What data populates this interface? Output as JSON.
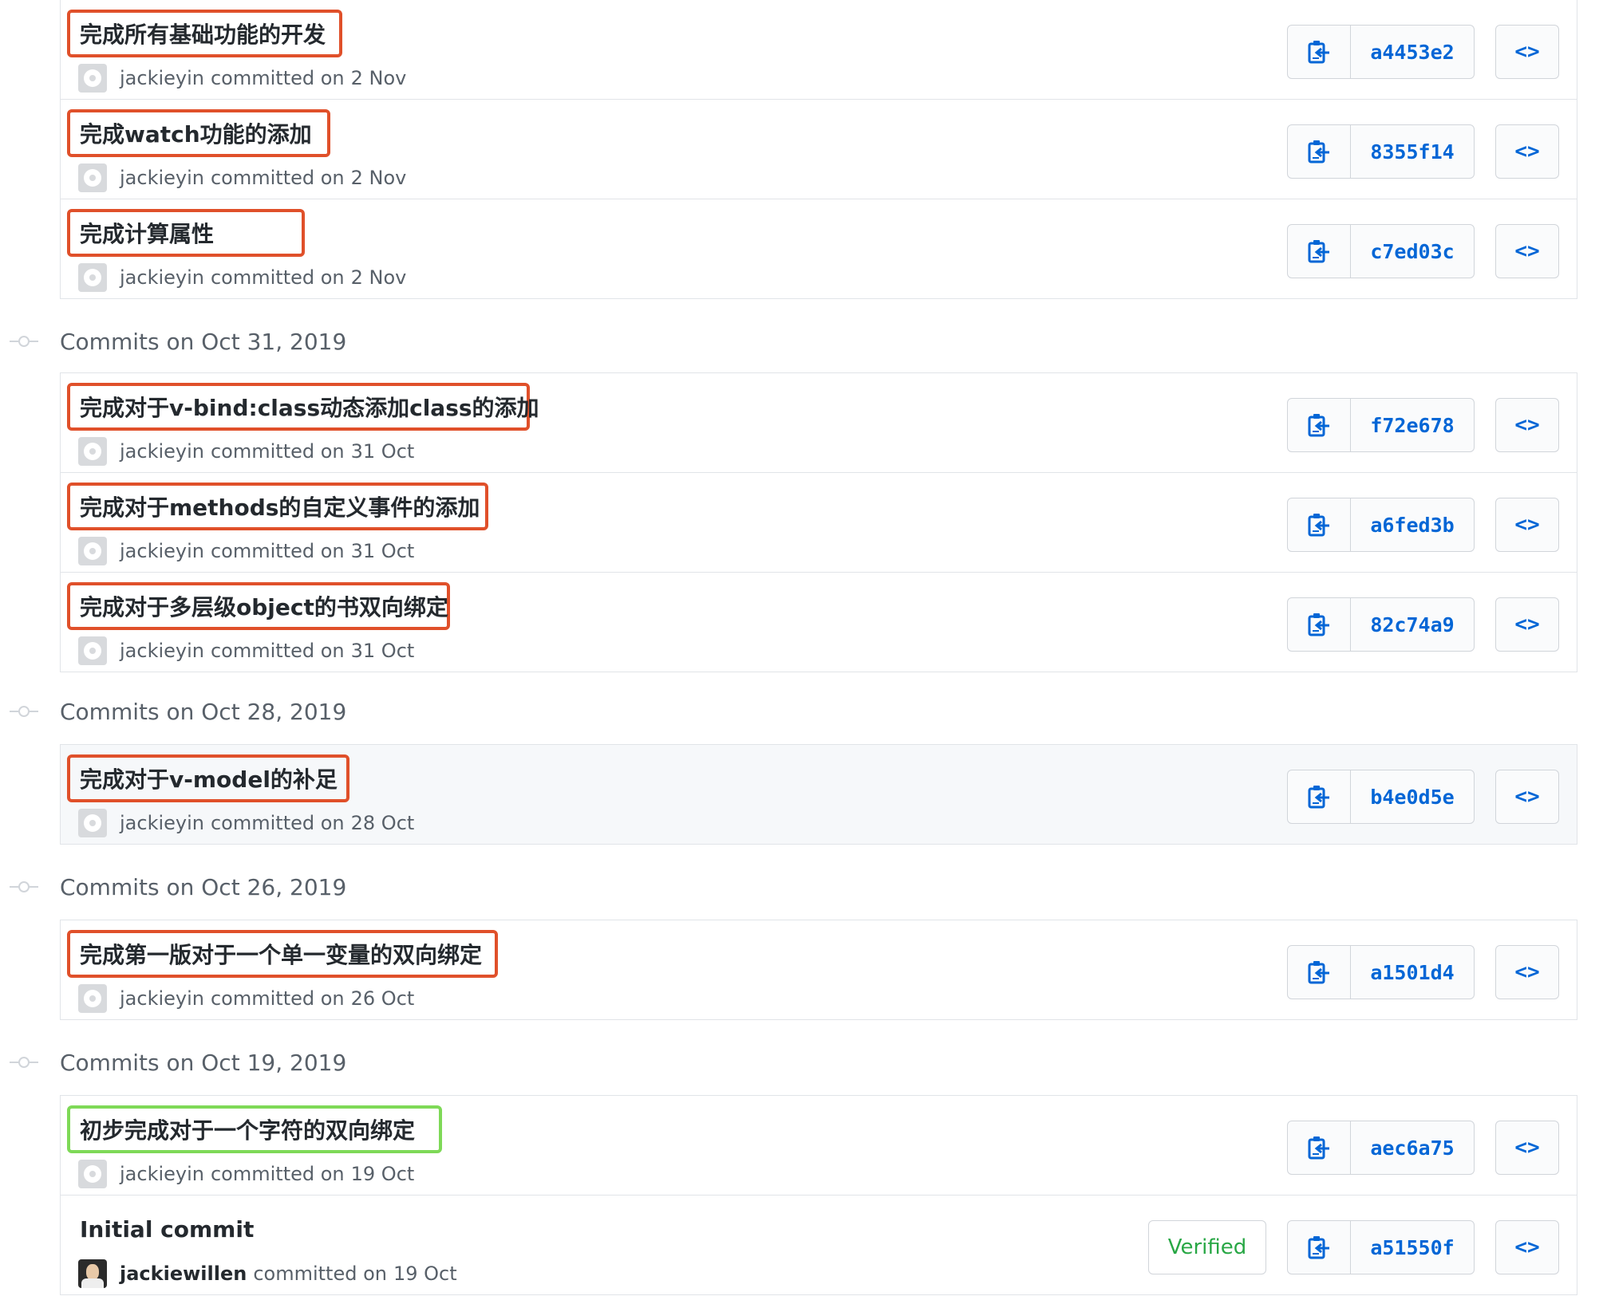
{
  "colors": {
    "accent": "#0366d6",
    "highlight_red": "#e0502a",
    "highlight_green": "#7ed957",
    "verified": "#28a745"
  },
  "icons": {
    "copy": "clipboard-icon",
    "browse": "code-brackets-icon"
  },
  "browse_label": "<>",
  "committed_word": "committed on",
  "groups": [
    {
      "date": "",
      "commits": [
        {
          "message": "完成所有基础功能的开发",
          "author": "jackieyin",
          "date": "2 Nov",
          "sha": "a4453e2"
        },
        {
          "message": "完成watch功能的添加",
          "author": "jackieyin",
          "date": "2 Nov",
          "sha": "8355f14"
        },
        {
          "message": "完成计算属性",
          "author": "jackieyin",
          "date": "2 Nov",
          "sha": "c7ed03c"
        }
      ]
    },
    {
      "date": "Commits on Oct 31, 2019",
      "commits": [
        {
          "message": "完成对于v-bind:class动态添加class的添加",
          "author": "jackieyin",
          "date": "31 Oct",
          "sha": "f72e678"
        },
        {
          "message": "完成对于methods的自定义事件的添加",
          "author": "jackieyin",
          "date": "31 Oct",
          "sha": "a6fed3b"
        },
        {
          "message": "完成对于多层级object的书双向绑定",
          "author": "jackieyin",
          "date": "31 Oct",
          "sha": "82c74a9"
        }
      ]
    },
    {
      "date": "Commits on Oct 28, 2019",
      "commits": [
        {
          "message": "完成对于v-model的补足",
          "author": "jackieyin",
          "date": "28 Oct",
          "sha": "b4e0d5e"
        }
      ]
    },
    {
      "date": "Commits on Oct 26, 2019",
      "commits": [
        {
          "message": "完成第一版对于一个单一变量的双向绑定",
          "author": "jackieyin",
          "date": "26 Oct",
          "sha": "a1501d4"
        }
      ]
    },
    {
      "date": "Commits on Oct 19, 2019",
      "commits": [
        {
          "message": "初步完成对于一个字符的双向绑定",
          "author": "jackieyin",
          "date": "19 Oct",
          "sha": "aec6a75"
        },
        {
          "message": "Initial commit",
          "author": "jackiewillen",
          "date": "19 Oct",
          "sha": "a51550f",
          "badge": "Verified"
        }
      ]
    }
  ]
}
